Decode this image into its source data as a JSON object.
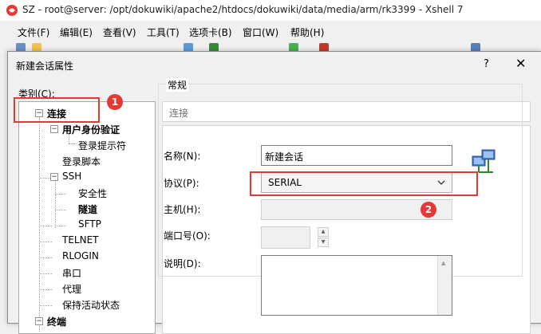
{
  "window": {
    "title": "SZ - root@server: /opt/dokuwiki/apache2/htdocs/dokuwiki/data/media/arm/rk3399 - Xshell 7",
    "menu": [
      "文件(F)",
      "编辑(E)",
      "查看(V)",
      "工具(T)",
      "选项卡(B)",
      "窗口(W)",
      "帮助(H)"
    ]
  },
  "dialog": {
    "title": "新建会话属性",
    "help": "?",
    "close": "✕",
    "category_label": "类别(C):",
    "tree": [
      {
        "label": "连接"
      },
      {
        "label": "用户身份验证"
      },
      {
        "label": "登录提示符"
      },
      {
        "label": "登录脚本"
      },
      {
        "label": "SSH"
      },
      {
        "label": "安全性"
      },
      {
        "label": "隧道"
      },
      {
        "label": "SFTP"
      },
      {
        "label": "TELNET"
      },
      {
        "label": "RLOGIN"
      },
      {
        "label": "串口"
      },
      {
        "label": "代理"
      },
      {
        "label": "保持活动状态"
      },
      {
        "label": "终端"
      }
    ],
    "panel_title": "连接",
    "group_label": "常规",
    "fields": {
      "name_label": "名称(N):",
      "name_value": "新建会话",
      "protocol_label": "协议(P):",
      "protocol_value": "SERIAL",
      "host_label": "主机(H):",
      "port_label": "端口号(O):",
      "desc_label": "说明(D):"
    }
  },
  "annotations": {
    "badge1": "1",
    "badge2": "2",
    "color": "#e53935"
  }
}
